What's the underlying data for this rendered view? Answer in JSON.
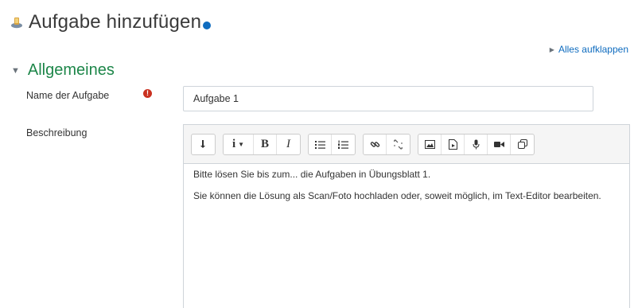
{
  "header": {
    "title": "Aufgabe hinzufügen",
    "icon": "assignment-icon",
    "help_icon": "help-icon"
  },
  "expand_all": "Alles aufklappen",
  "section": {
    "title": "Allgemeines",
    "expanded": true
  },
  "fields": {
    "name_label": "Name der Aufgabe",
    "name_value": "Aufgabe 1",
    "required_icon": "!",
    "description_label": "Beschreibung"
  },
  "editor": {
    "toolbar_icons": [
      "show-more-icon",
      "paragraph-styles-icon",
      "bold-icon",
      "italic-icon",
      "unordered-list-icon",
      "ordered-list-icon",
      "link-icon",
      "unlink-icon",
      "image-icon",
      "media-icon",
      "record-audio-icon",
      "record-video-icon",
      "manage-files-icon"
    ],
    "bold_label": "B",
    "italic_label": "I",
    "paragraph_1": "Bitte lösen Sie bis zum... die Aufgaben in Übungsblatt 1.",
    "paragraph_2": "Sie können die Lösung als Scan/Foto hochladen oder, soweit möglich, im Text-Editor bearbeiten."
  },
  "colors": {
    "section_green": "#1d8649",
    "link_blue": "#0f6cbf",
    "required_red": "#ca3120"
  }
}
